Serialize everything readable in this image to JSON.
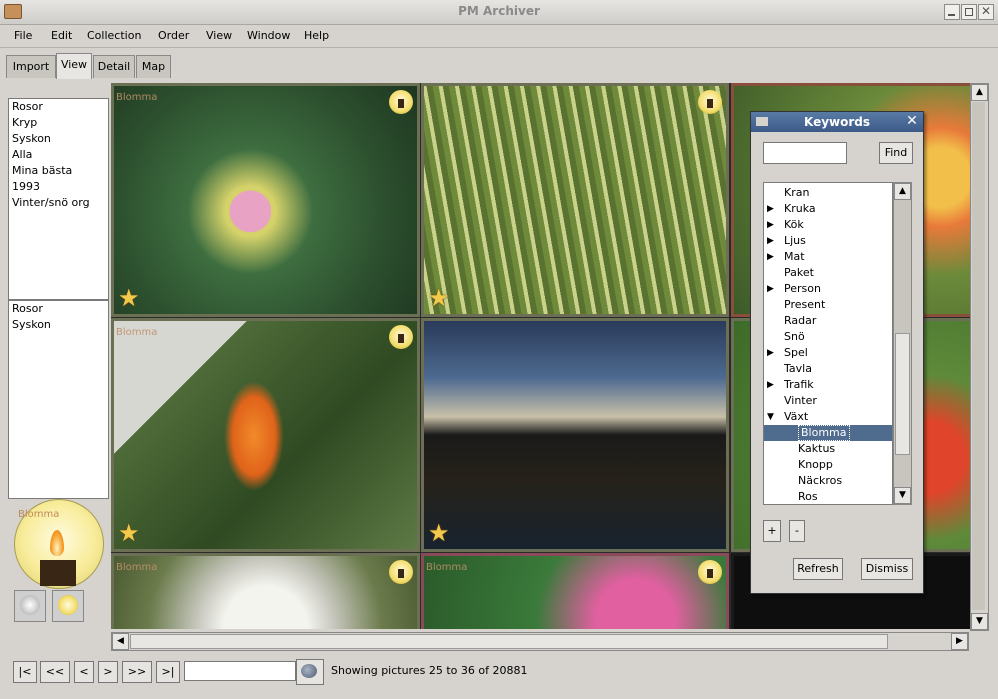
{
  "window": {
    "title": "PM Archiver"
  },
  "menu": [
    "File",
    "Edit",
    "Collection",
    "Order",
    "View",
    "Window",
    "Help"
  ],
  "tabs": [
    "Import",
    "View",
    "Detail",
    "Map"
  ],
  "active_tab": "View",
  "collections": [
    "Rosor",
    "Kryp",
    "Syskon",
    "Alla",
    "Mina bästa",
    "1993",
    "Vinter/snö org"
  ],
  "selected_collections": [
    "Rosor",
    "Syskon"
  ],
  "preview_label": "Blomma",
  "photos": [
    {
      "label": "Blomma",
      "subject": "water lily",
      "starred": true
    },
    {
      "label": "",
      "subject": "green flower buds",
      "starred": true
    },
    {
      "label": "",
      "subject": "orange flowers",
      "starred": true
    },
    {
      "label": "Blomma",
      "subject": "bird of paradise flower",
      "starred": true
    },
    {
      "label": "",
      "subject": "canal at dusk",
      "starred": true
    },
    {
      "label": "",
      "subject": "red tulips",
      "starred": true
    },
    {
      "label": "Blomma",
      "subject": "dandelion",
      "starred": false
    },
    {
      "label": "Blomma",
      "subject": "pink flower",
      "starred": false
    },
    {
      "label": "",
      "subject": "dark",
      "starred": false
    }
  ],
  "navigation": {
    "first": "|<",
    "prev_page": "<<",
    "prev": "<",
    "next": ">",
    "next_page": ">>",
    "last": ">|",
    "search_value": "",
    "status": "Showing pictures 25 to 36 of 20881"
  },
  "keywords_dialog": {
    "title": "Keywords",
    "search_value": "",
    "find_label": "Find",
    "items": [
      {
        "label": "Kran",
        "expandable": false,
        "indent": 0
      },
      {
        "label": "Kruka",
        "expandable": true,
        "indent": 0
      },
      {
        "label": "Kök",
        "expandable": true,
        "indent": 0
      },
      {
        "label": "Ljus",
        "expandable": true,
        "indent": 0
      },
      {
        "label": "Mat",
        "expandable": true,
        "indent": 0
      },
      {
        "label": "Paket",
        "expandable": false,
        "indent": 0
      },
      {
        "label": "Person",
        "expandable": true,
        "indent": 0
      },
      {
        "label": "Present",
        "expandable": false,
        "indent": 0
      },
      {
        "label": "Radar",
        "expandable": false,
        "indent": 0
      },
      {
        "label": "Snö",
        "expandable": false,
        "indent": 0
      },
      {
        "label": "Spel",
        "expandable": true,
        "indent": 0
      },
      {
        "label": "Tavla",
        "expandable": false,
        "indent": 0
      },
      {
        "label": "Trafik",
        "expandable": true,
        "indent": 0
      },
      {
        "label": "Vinter",
        "expandable": false,
        "indent": 0
      },
      {
        "label": "Växt",
        "expanded": true,
        "indent": 0
      },
      {
        "label": "Blomma",
        "expandable": false,
        "indent": 1,
        "selected": true
      },
      {
        "label": "Kaktus",
        "expandable": false,
        "indent": 1
      },
      {
        "label": "Knopp",
        "expandable": false,
        "indent": 1
      },
      {
        "label": "Näckros",
        "expandable": false,
        "indent": 1
      },
      {
        "label": "Ros",
        "expandable": false,
        "indent": 1
      }
    ],
    "add_label": "+",
    "remove_label": "-",
    "refresh_label": "Refresh",
    "dismiss_label": "Dismiss"
  }
}
